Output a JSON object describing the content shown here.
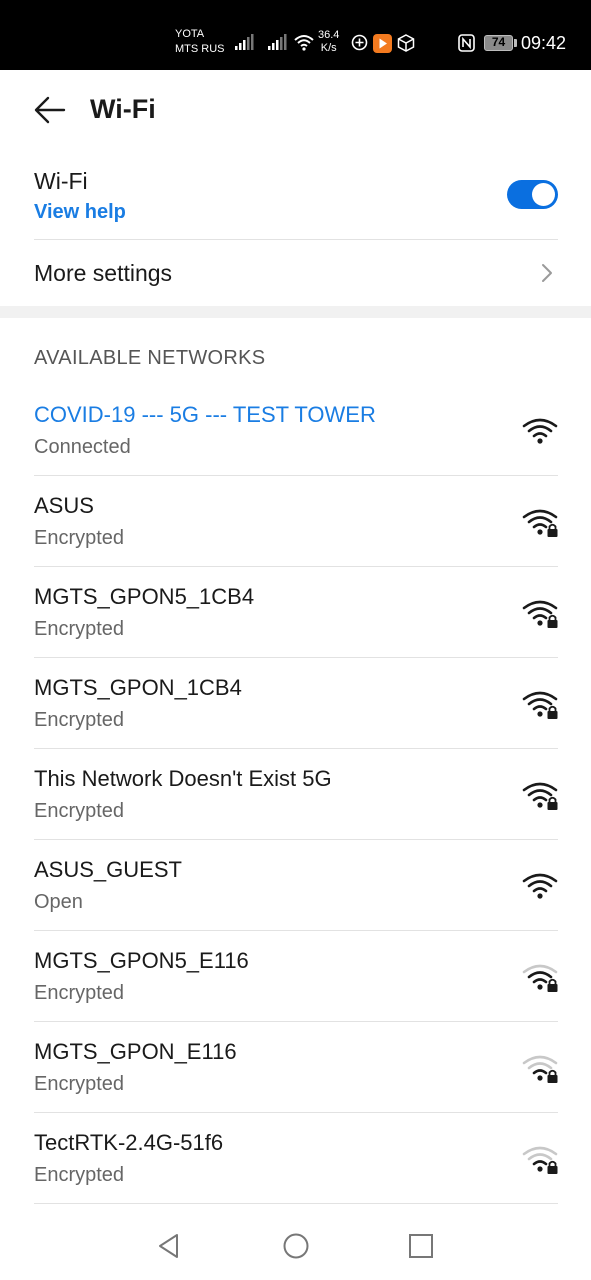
{
  "status_bar": {
    "carrier_1": "YOTA",
    "carrier_2": "MTS RUS",
    "speed_value": "36.4",
    "speed_unit": "K/s",
    "battery": "74",
    "time": "09:42",
    "icons": [
      "signal-icon",
      "signal-icon",
      "wifi-icon",
      "status-icon",
      "play-icon",
      "box-icon",
      "nfc-icon",
      "battery-icon"
    ]
  },
  "header": {
    "back_icon": "back-arrow-icon",
    "title": "Wi-Fi"
  },
  "wifi": {
    "label": "Wi-Fi",
    "help_link": "View help",
    "enabled": true
  },
  "more_settings": {
    "label": "More settings",
    "icon": "chevron-right-icon"
  },
  "networks_title": "AVAILABLE NETWORKS",
  "networks": [
    {
      "name": "COVID-19 --- 5G --- TEST TOWER",
      "status": "Connected",
      "locked": false,
      "bars": 3,
      "connected": true
    },
    {
      "name": "ASUS",
      "status": "Encrypted",
      "locked": true,
      "bars": 3
    },
    {
      "name": "MGTS_GPON5_1CB4",
      "status": "Encrypted",
      "locked": true,
      "bars": 3
    },
    {
      "name": "MGTS_GPON_1CB4",
      "status": "Encrypted",
      "locked": true,
      "bars": 3
    },
    {
      "name": "This Network Doesn't Exist 5G",
      "status": "Encrypted",
      "locked": true,
      "bars": 3
    },
    {
      "name": "ASUS_GUEST",
      "status": "Open",
      "locked": false,
      "bars": 3
    },
    {
      "name": "MGTS_GPON5_E116",
      "status": "Encrypted",
      "locked": true,
      "bars": 2
    },
    {
      "name": "MGTS_GPON_E116",
      "status": "Encrypted",
      "locked": true,
      "bars": 1
    },
    {
      "name": "TectRTK-2.4G-51f6",
      "status": "Encrypted",
      "locked": true,
      "bars": 1
    }
  ],
  "nav_bar": {
    "icons": [
      "nav-back-icon",
      "nav-home-icon",
      "nav-recents-icon"
    ]
  },
  "colors": {
    "accent": "#1a7de3",
    "toggle": "#0a6fe0"
  }
}
